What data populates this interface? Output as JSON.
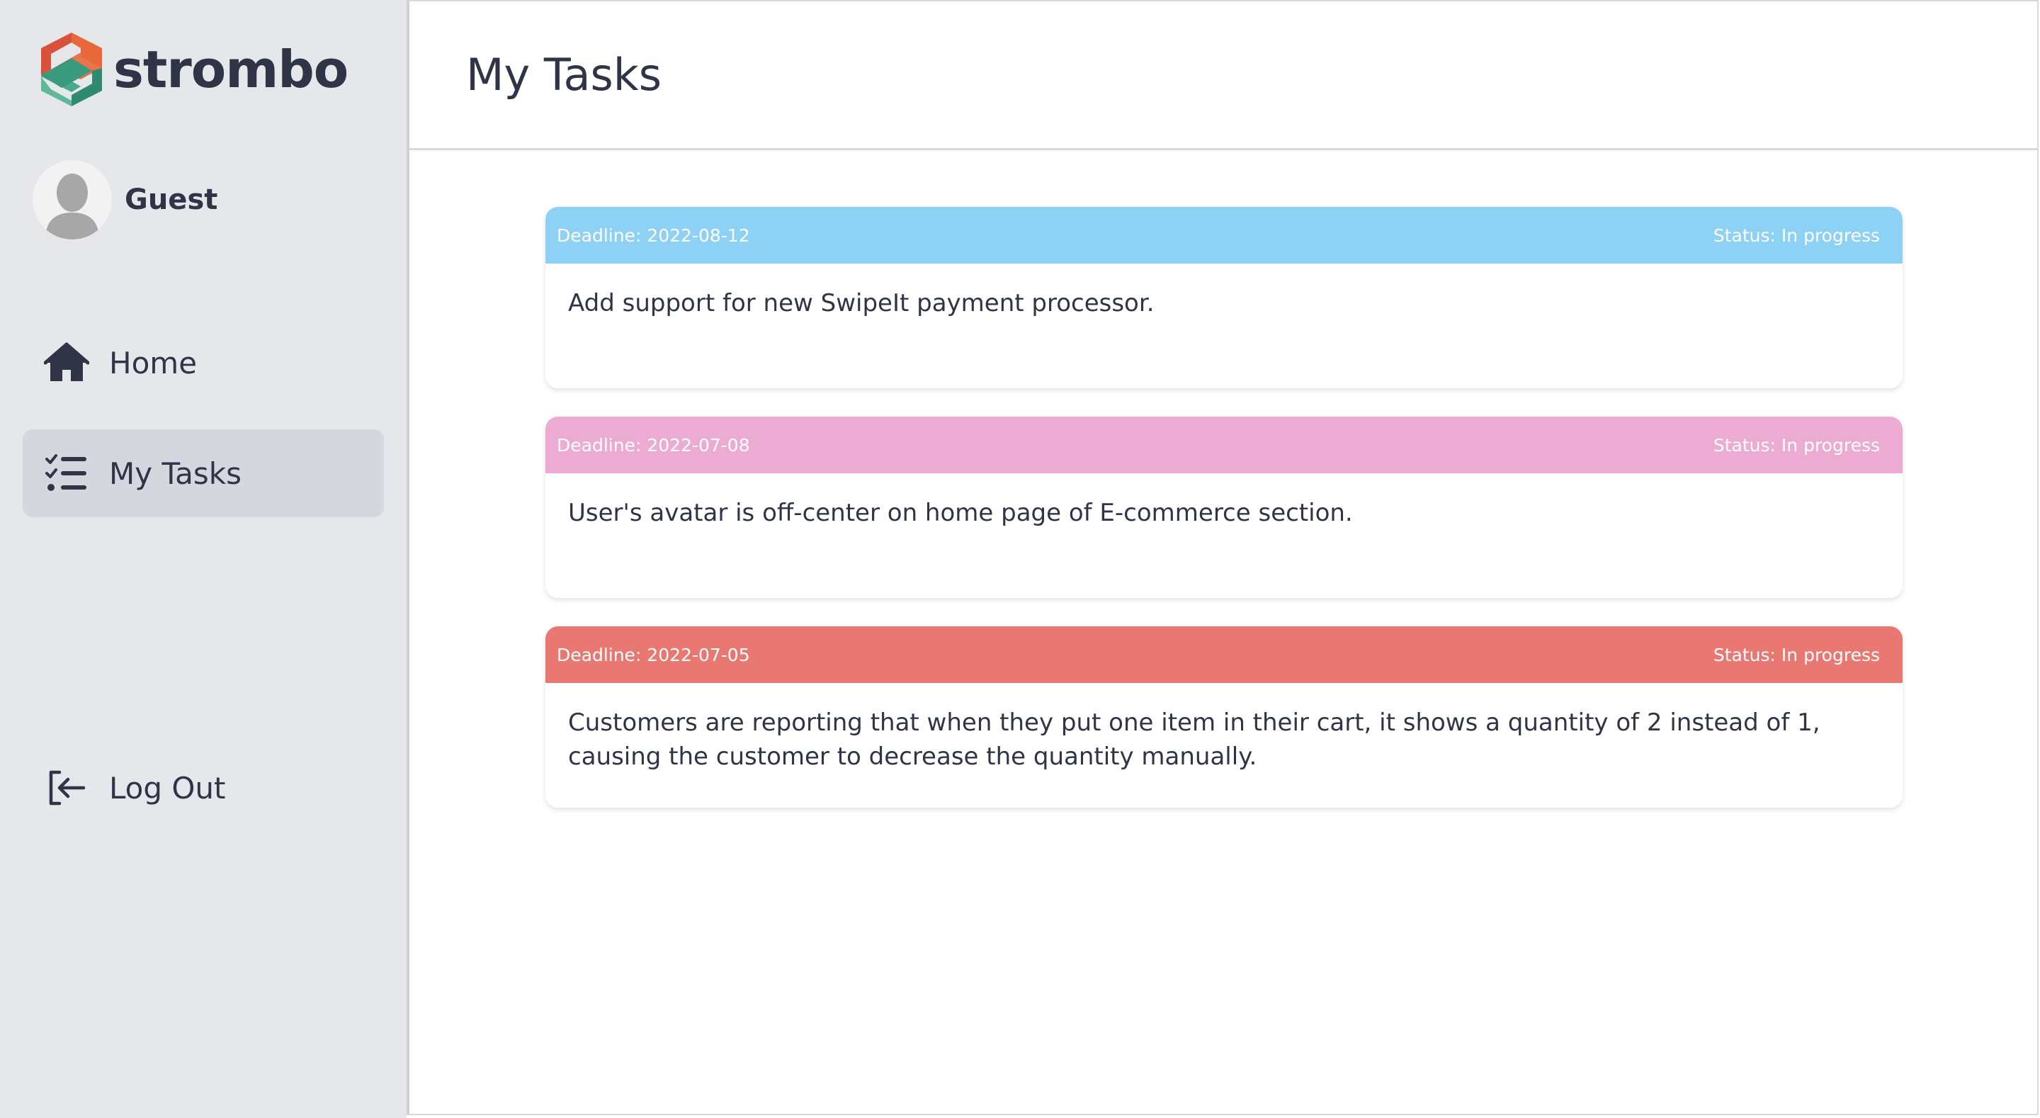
{
  "brand": {
    "name": "strombo"
  },
  "user": {
    "name": "Guest"
  },
  "nav": {
    "home": "Home",
    "tasks": "My Tasks",
    "logout": "Log Out"
  },
  "page": {
    "title": "My Tasks"
  },
  "tasks": [
    {
      "deadline": "Deadline: 2022-08-12",
      "status": "Status: In progress",
      "description": "Add support for new SwipeIt payment processor.",
      "color": "#8dd1f4"
    },
    {
      "deadline": "Deadline: 2022-07-08",
      "status": "Status: In progress",
      "description": "User's avatar is off-center on home page of E-commerce section.",
      "color": "#ebabd2"
    },
    {
      "deadline": "Deadline: 2022-07-05",
      "status": "Status: In progress",
      "description": "Customers are reporting that when they put one item in their cart, it shows a quantity of 2 instead of 1, causing the customer to decrease the quantity manually.",
      "color": "#e97873"
    }
  ],
  "icons": {
    "logo": "strombo-logo-icon",
    "avatar": "user-avatar-icon",
    "home": "home-icon",
    "tasks": "task-list-icon",
    "logout": "logout-icon"
  },
  "colors": {
    "sidebar": "#e5e7eb",
    "active_nav": "#d4d7dd",
    "text": "#2f3547"
  }
}
